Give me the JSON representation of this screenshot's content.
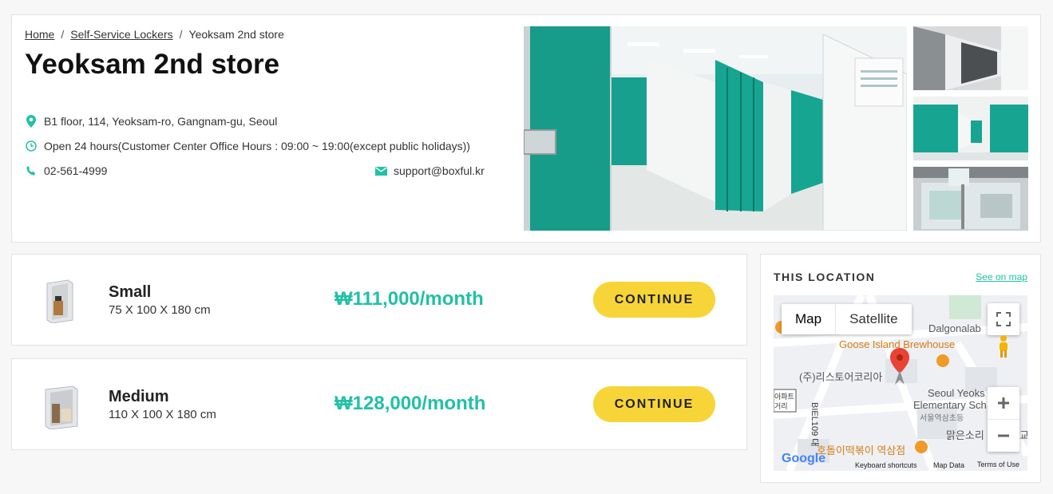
{
  "breadcrumb": {
    "home": "Home",
    "section": "Self-Service Lockers",
    "current": "Yeoksam 2nd store",
    "separator": "/"
  },
  "store": {
    "title": "Yeoksam 2nd store",
    "address": "B1 floor, 114, Yeoksam-ro, Gangnam-gu, Seoul",
    "hours": "Open 24 hours(Customer Center Office Hours : 09:00 ~ 19:00(except public holidays))",
    "phone": "02-561-4999",
    "email": "support@boxful.kr"
  },
  "icons": {
    "address": "map-pin-icon",
    "hours": "clock-icon",
    "phone": "phone-icon",
    "email": "mail-icon"
  },
  "lockers": [
    {
      "name": "Small",
      "size": "75 X 100 X 180 cm",
      "price": "₩111,000/month",
      "button": "CONTINUE"
    },
    {
      "name": "Medium",
      "size": "110 X 100 X 180 cm",
      "price": "₩128,000/month",
      "button": "CONTINUE"
    }
  ],
  "location": {
    "title": "THIS LOCATION",
    "see_on_map": "See on map",
    "map": {
      "type_map": "Map",
      "type_satellite": "Satellite",
      "labels": {
        "dalgona": "Dalgonalab",
        "goose": "Goose Island Brewhouse",
        "restore": "(주)리스토어코리아",
        "school_en": "Seoul Yeoks",
        "school_en2": "Elementary Sch",
        "school_kr": "서울역삼초등",
        "malgeun": "맑은소리",
        "hodori": "호돌이떡볶이 역삼점",
        "apt": "아파트",
        "street": "거리",
        "bldg": "BIEL109 대",
        "gyo": "교"
      },
      "footer": {
        "google": "Google",
        "shortcuts": "Keyboard shortcuts",
        "mapdata": "Map Data",
        "terms": "Terms of Use"
      }
    }
  },
  "colors": {
    "accent": "#22c0a6",
    "button": "#f7d538",
    "locker_teal": "#14a894"
  }
}
